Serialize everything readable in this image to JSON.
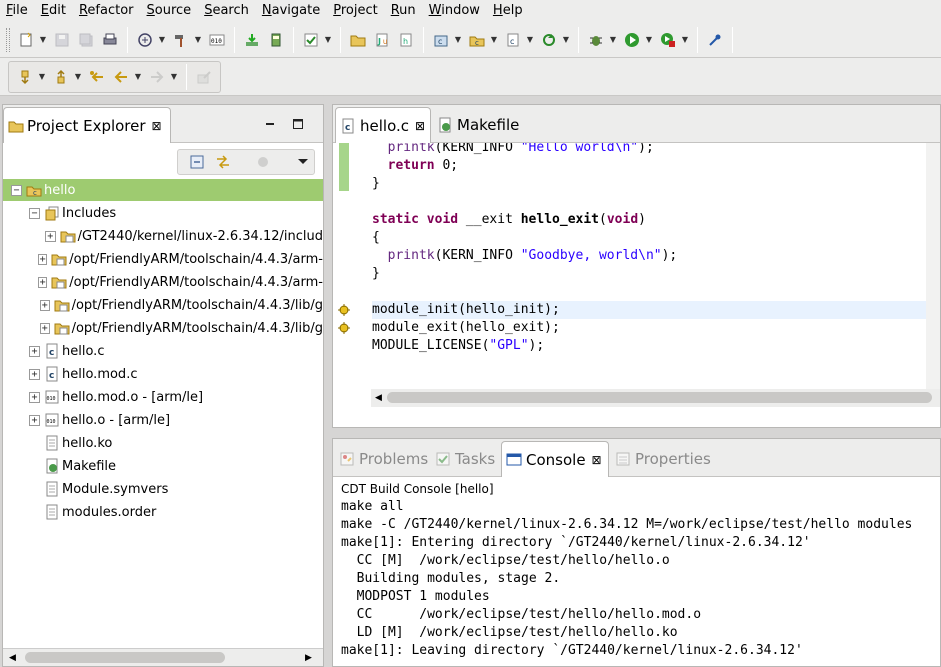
{
  "menubar": {
    "items": [
      "File",
      "Edit",
      "Refactor",
      "Source",
      "Search",
      "Navigate",
      "Project",
      "Run",
      "Window",
      "Help"
    ]
  },
  "toolbar_icons": [
    "new-icon",
    "save-icon",
    "save-all-icon",
    "print-icon",
    "build-all-icon",
    "hammer-build-icon",
    "binary-icon",
    "download-icon",
    "memory-icon",
    "checklist-icon",
    "open-folder-icon",
    "new-source-file-icon",
    "new-header-file-icon",
    "new-class-icon",
    "new-project-icon",
    "new-c-file-icon",
    "refresh-icon",
    "debug-icon",
    "run-icon",
    "stop-run-icon",
    "pin-icon",
    "next-annotation-icon",
    "previous-annotation-icon",
    "last-edit-icon",
    "back-icon",
    "forward-icon",
    "pin-editor-icon"
  ],
  "project_explorer": {
    "title": "Project Explorer",
    "tree": [
      {
        "label": "hello",
        "depth": 0,
        "expander": "−",
        "icon": "c-project-icon",
        "selected": true
      },
      {
        "label": "Includes",
        "depth": 1,
        "expander": "−",
        "icon": "includes-icon"
      },
      {
        "label": "/GT2440/kernel/linux-2.6.34.12/includ",
        "depth": 2,
        "expander": "+",
        "icon": "include-folder-icon"
      },
      {
        "label": "/opt/FriendlyARM/toolschain/4.4.3/arm-",
        "depth": 2,
        "expander": "+",
        "icon": "include-folder-icon"
      },
      {
        "label": "/opt/FriendlyARM/toolschain/4.4.3/arm-",
        "depth": 2,
        "expander": "+",
        "icon": "include-folder-icon"
      },
      {
        "label": "/opt/FriendlyARM/toolschain/4.4.3/lib/g",
        "depth": 2,
        "expander": "+",
        "icon": "include-folder-icon"
      },
      {
        "label": "/opt/FriendlyARM/toolschain/4.4.3/lib/g",
        "depth": 2,
        "expander": "+",
        "icon": "include-folder-icon"
      },
      {
        "label": "hello.c",
        "depth": 1,
        "expander": "+",
        "icon": "c-file-icon"
      },
      {
        "label": "hello.mod.c",
        "depth": 1,
        "expander": "+",
        "icon": "c-file-icon"
      },
      {
        "label": "hello.mod.o - [arm/le]",
        "depth": 1,
        "expander": "+",
        "icon": "object-file-icon"
      },
      {
        "label": "hello.o - [arm/le]",
        "depth": 1,
        "expander": "+",
        "icon": "object-file-icon"
      },
      {
        "label": "hello.ko",
        "depth": 1,
        "expander": "",
        "icon": "text-file-icon"
      },
      {
        "label": "Makefile",
        "depth": 1,
        "expander": "",
        "icon": "makefile-icon"
      },
      {
        "label": "Module.symvers",
        "depth": 1,
        "expander": "",
        "icon": "text-file-icon"
      },
      {
        "label": "modules.order",
        "depth": 1,
        "expander": "",
        "icon": "text-file-icon"
      }
    ]
  },
  "editor": {
    "tabs": [
      {
        "label": "hello.c",
        "active": true
      },
      {
        "label": "Makefile",
        "active": false
      }
    ],
    "lines": [
      {
        "parts": [
          [
            "",
            "  "
          ],
          [
            "fn-call",
            "printk"
          ],
          [
            "",
            "(KERN_INFO "
          ],
          [
            "str",
            "\"Hello world\\n\""
          ],
          [
            "",
            ");"
          ]
        ]
      },
      {
        "parts": [
          [
            "",
            "  "
          ],
          [
            "kw",
            "return"
          ],
          [
            "",
            " 0;"
          ]
        ]
      },
      {
        "parts": [
          [
            "",
            "}"
          ]
        ]
      },
      {
        "parts": [
          [
            "",
            ""
          ]
        ]
      },
      {
        "parts": [
          [
            "kw",
            "static"
          ],
          [
            "",
            " "
          ],
          [
            "kw",
            "void"
          ],
          [
            "",
            " __exit "
          ],
          [
            "fn",
            "hello_exit"
          ],
          [
            "",
            "("
          ],
          [
            "kw",
            "void"
          ],
          [
            "",
            ")"
          ]
        ]
      },
      {
        "parts": [
          [
            "",
            "{"
          ]
        ]
      },
      {
        "parts": [
          [
            "",
            "  "
          ],
          [
            "fn-call",
            "printk"
          ],
          [
            "",
            "(KERN_INFO "
          ],
          [
            "str",
            "\"Goodbye, world\\n\""
          ],
          [
            "",
            ");"
          ]
        ]
      },
      {
        "parts": [
          [
            "",
            "}"
          ]
        ]
      },
      {
        "parts": [
          [
            "",
            ""
          ]
        ]
      },
      {
        "parts": [
          [
            "",
            "module_init(hello_init);"
          ]
        ],
        "current": true,
        "marker": true
      },
      {
        "parts": [
          [
            "",
            "module_exit(hello_exit);"
          ]
        ],
        "marker": true
      },
      {
        "parts": [
          [
            "",
            "MODULE_LICENSE("
          ],
          [
            "str",
            "\"GPL\""
          ],
          [
            "",
            ");"
          ]
        ]
      }
    ]
  },
  "console": {
    "tabs": [
      {
        "label": "Problems",
        "active": false,
        "icon": "problems-icon"
      },
      {
        "label": "Tasks",
        "active": false,
        "icon": "tasks-icon"
      },
      {
        "label": "Console",
        "active": true,
        "icon": "console-icon"
      },
      {
        "label": "Properties",
        "active": false,
        "icon": "properties-icon"
      }
    ],
    "title": "CDT Build Console [hello]",
    "lines": [
      "make all",
      "make -C /GT2440/kernel/linux-2.6.34.12 M=/work/eclipse/test/hello modules",
      "make[1]: Entering directory `/GT2440/kernel/linux-2.6.34.12'",
      "  CC [M]  /work/eclipse/test/hello/hello.o",
      "  Building modules, stage 2.",
      "  MODPOST 1 modules",
      "  CC      /work/eclipse/test/hello/hello.mod.o",
      "  LD [M]  /work/eclipse/test/hello/hello.ko",
      "make[1]: Leaving directory `/GT2440/kernel/linux-2.6.34.12'"
    ]
  }
}
